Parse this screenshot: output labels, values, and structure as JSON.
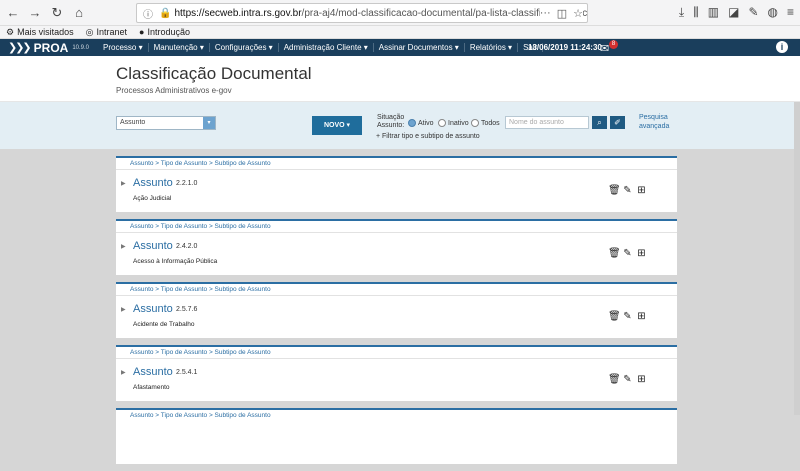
{
  "browser": {
    "url_host": "https://secweb.intra.rs.gov.br",
    "url_path": "/pra-aj4/mod-classificacao-documental/pa-lista-classificacao-documental.xh",
    "bookmarks": [
      "Mais visitados",
      "Intranet",
      "Introdução"
    ]
  },
  "app": {
    "logo": "PROA",
    "logo_sub": "PRA12",
    "version": "10.9.0",
    "menu": [
      "Processo ▾",
      "Manutenção ▾",
      "Configurações ▾",
      "Administração Cliente ▾",
      "Assinar Documentos ▾",
      "Relatórios ▾",
      "Sair"
    ],
    "datetime": "13/06/2019 11:24:30",
    "mail_count": "8",
    "help": "i"
  },
  "header": {
    "title": "Classificação Documental",
    "subtitle": "Processos Administrativos e-gov"
  },
  "filter": {
    "select_value": "Assunto",
    "novo_label": "NOVO ▾",
    "situacao_label_1": "Situação",
    "situacao_label_2": "Assunto:",
    "options": [
      "Ativo",
      "Inativo",
      "Todos"
    ],
    "selected_option": "Ativo",
    "search_placeholder": "Nome do assunto",
    "advanced_1": "Pesquisa",
    "advanced_2": "avançada",
    "filter_link": "+ Filtrar tipo e subtipo de assunto"
  },
  "cards": [
    {
      "crumb": "Assunto > Tipo de Assunto > Subtipo de Assunto",
      "type": "Assunto",
      "code": "2.2.1.0",
      "desc": "Ação Judicial"
    },
    {
      "crumb": "Assunto > Tipo de Assunto > Subtipo de Assunto",
      "type": "Assunto",
      "code": "2.4.2.0",
      "desc": "Acesso à Informação Pública"
    },
    {
      "crumb": "Assunto > Tipo de Assunto > Subtipo de Assunto",
      "type": "Assunto",
      "code": "2.5.7.6",
      "desc": "Acidente de Trabalho"
    },
    {
      "crumb": "Assunto > Tipo de Assunto > Subtipo de Assunto",
      "type": "Assunto",
      "code": "2.5.4.1",
      "desc": "Afastamento"
    },
    {
      "crumb": "Assunto > Tipo de Assunto > Subtipo de Assunto",
      "type": "",
      "code": "",
      "desc": ""
    }
  ]
}
